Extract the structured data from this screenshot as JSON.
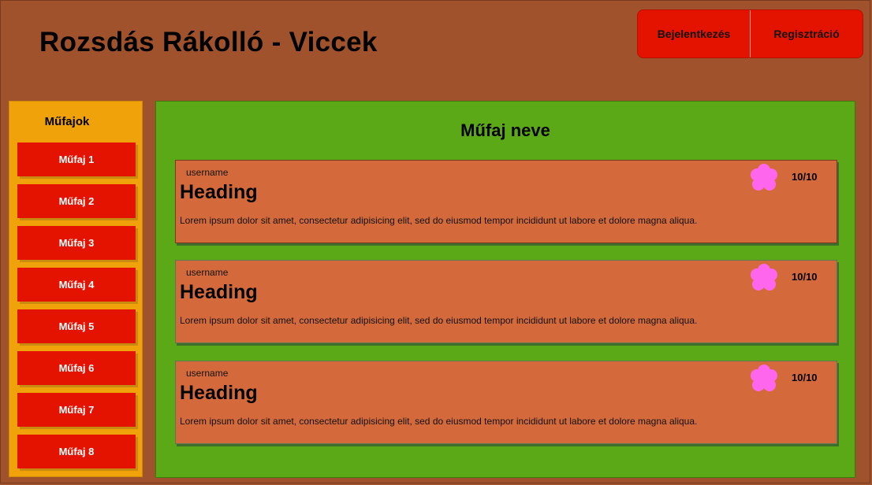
{
  "site": {
    "title": "Rozsdás Rákolló - Viccek"
  },
  "auth": {
    "login_label": "Bejelentkezés",
    "register_label": "Regisztráció"
  },
  "sidebar": {
    "title": "Műfajok",
    "items": [
      {
        "label": "Műfaj 1"
      },
      {
        "label": "Műfaj 2"
      },
      {
        "label": "Műfaj 3"
      },
      {
        "label": "Műfaj 4"
      },
      {
        "label": "Műfaj 5"
      },
      {
        "label": "Műfaj 6"
      },
      {
        "label": "Műfaj 7"
      },
      {
        "label": "Műfaj 8"
      }
    ]
  },
  "main": {
    "title": "Műfaj neve",
    "jokes": [
      {
        "username": "username",
        "heading": "Heading",
        "body": "Lorem ipsum dolor sit amet, consectetur adipisicing elit, sed do eiusmod tempor incididunt ut labore et dolore magna aliqua.",
        "score": "10/10",
        "icon": "flower-rating-icon"
      },
      {
        "username": "username",
        "heading": "Heading",
        "body": "Lorem ipsum dolor sit amet, consectetur adipisicing elit, sed do eiusmod tempor incididunt ut labore et dolore magna aliqua.",
        "score": "10/10",
        "icon": "flower-rating-icon"
      },
      {
        "username": "username",
        "heading": "Heading",
        "body": "Lorem ipsum dolor sit amet, consectetur adipisicing elit, sed do eiusmod tempor incididunt ut labore et dolore magna aliqua.",
        "score": "10/10",
        "icon": "flower-rating-icon"
      }
    ]
  },
  "colors": {
    "page_bg": "#a0522d",
    "accent_red": "#e31300",
    "sidebar_bg": "#f0a20a",
    "main_bg": "#5ba916",
    "card_bg": "#d46a3c",
    "rating_pink": "#ff66ee"
  }
}
